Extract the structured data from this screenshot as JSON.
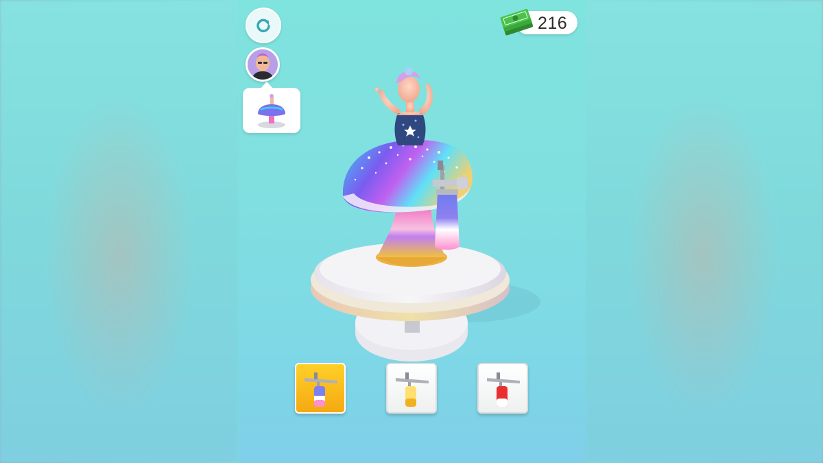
{
  "hud": {
    "money": "216",
    "money_icon": "cash-stack-icon",
    "restart_icon": "restart-icon"
  },
  "customer": {
    "avatar_icon": "customer-avatar",
    "order_icon": "mushroom-cake-order-icon"
  },
  "tools": [
    {
      "name": "airbrush-pastel",
      "selected": true,
      "paint_colors": [
        "#5b7cf0",
        "#ff8fd0"
      ]
    },
    {
      "name": "airbrush-yellow",
      "selected": false,
      "paint_colors": [
        "#ffe070",
        "#f0b020"
      ]
    },
    {
      "name": "airbrush-red",
      "selected": false,
      "paint_colors": [
        "#e83030",
        "#ffffff"
      ]
    }
  ],
  "colors": {
    "background": "#80e0e0",
    "selected_tool": "#f7b518",
    "turntable": "#eef0f2",
    "turntable_rim": "#e9d6a0"
  }
}
